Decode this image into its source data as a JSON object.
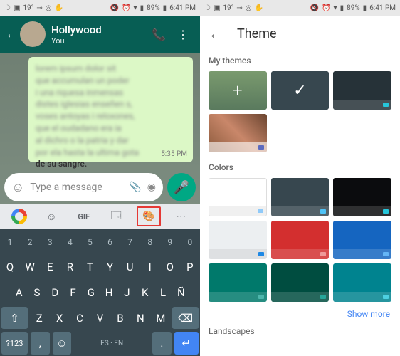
{
  "status": {
    "temp": "19°",
    "battery": "89%",
    "time": "6:41 PM"
  },
  "whatsapp": {
    "contact": "Hollywood",
    "sub": "You",
    "bubble_blur1": "lorem ipsum dolor sit",
    "bubble_blur2": "que accumulan un poder",
    "bubble_blur3": "i una riquesa inmensas",
    "bubble_blur4": "distes iglesias enseñen s,",
    "bubble_blur5": "voses antoyas i reloxones,",
    "bubble_blur6": "que el oudadano era ia",
    "bubble_blur7": "al dichro o la patria y dar",
    "bubble_blur8": "por ela hasta la ultima gota",
    "bubble_last": "de su sangre.",
    "bubble_time": "5:35 PM",
    "input_placeholder": "Type a message"
  },
  "keyboard": {
    "row_num": [
      "1",
      "2",
      "3",
      "4",
      "5",
      "6",
      "7",
      "8",
      "9",
      "0"
    ],
    "row1": [
      "Q",
      "W",
      "E",
      "R",
      "T",
      "Y",
      "U",
      "I",
      "O",
      "P"
    ],
    "row2": [
      "A",
      "S",
      "D",
      "F",
      "G",
      "H",
      "J",
      "K",
      "L",
      "Ñ"
    ],
    "row3": [
      "Z",
      "X",
      "C",
      "V",
      "B",
      "N",
      "M"
    ],
    "sym": "?123",
    "lang": "ES · EN",
    "gif": "GIF"
  },
  "theme": {
    "title": "Theme",
    "s1": "My themes",
    "s2": "Colors",
    "s3": "Landscapes",
    "showmore": "Show more",
    "colors": [
      "#ffffff",
      "#37474f",
      "#0b0c0e",
      "#eceff1",
      "#d32f2f",
      "#1565c0",
      "#00796b",
      "#004d40",
      "#00838f"
    ],
    "dots": [
      "#90caf9",
      "#4fc3f7",
      "#26c6da",
      "#1e88e5",
      "#ef9a9a",
      "#64b5f6",
      "#4db6ac",
      "#26a69a",
      "#4dd0e1"
    ]
  }
}
